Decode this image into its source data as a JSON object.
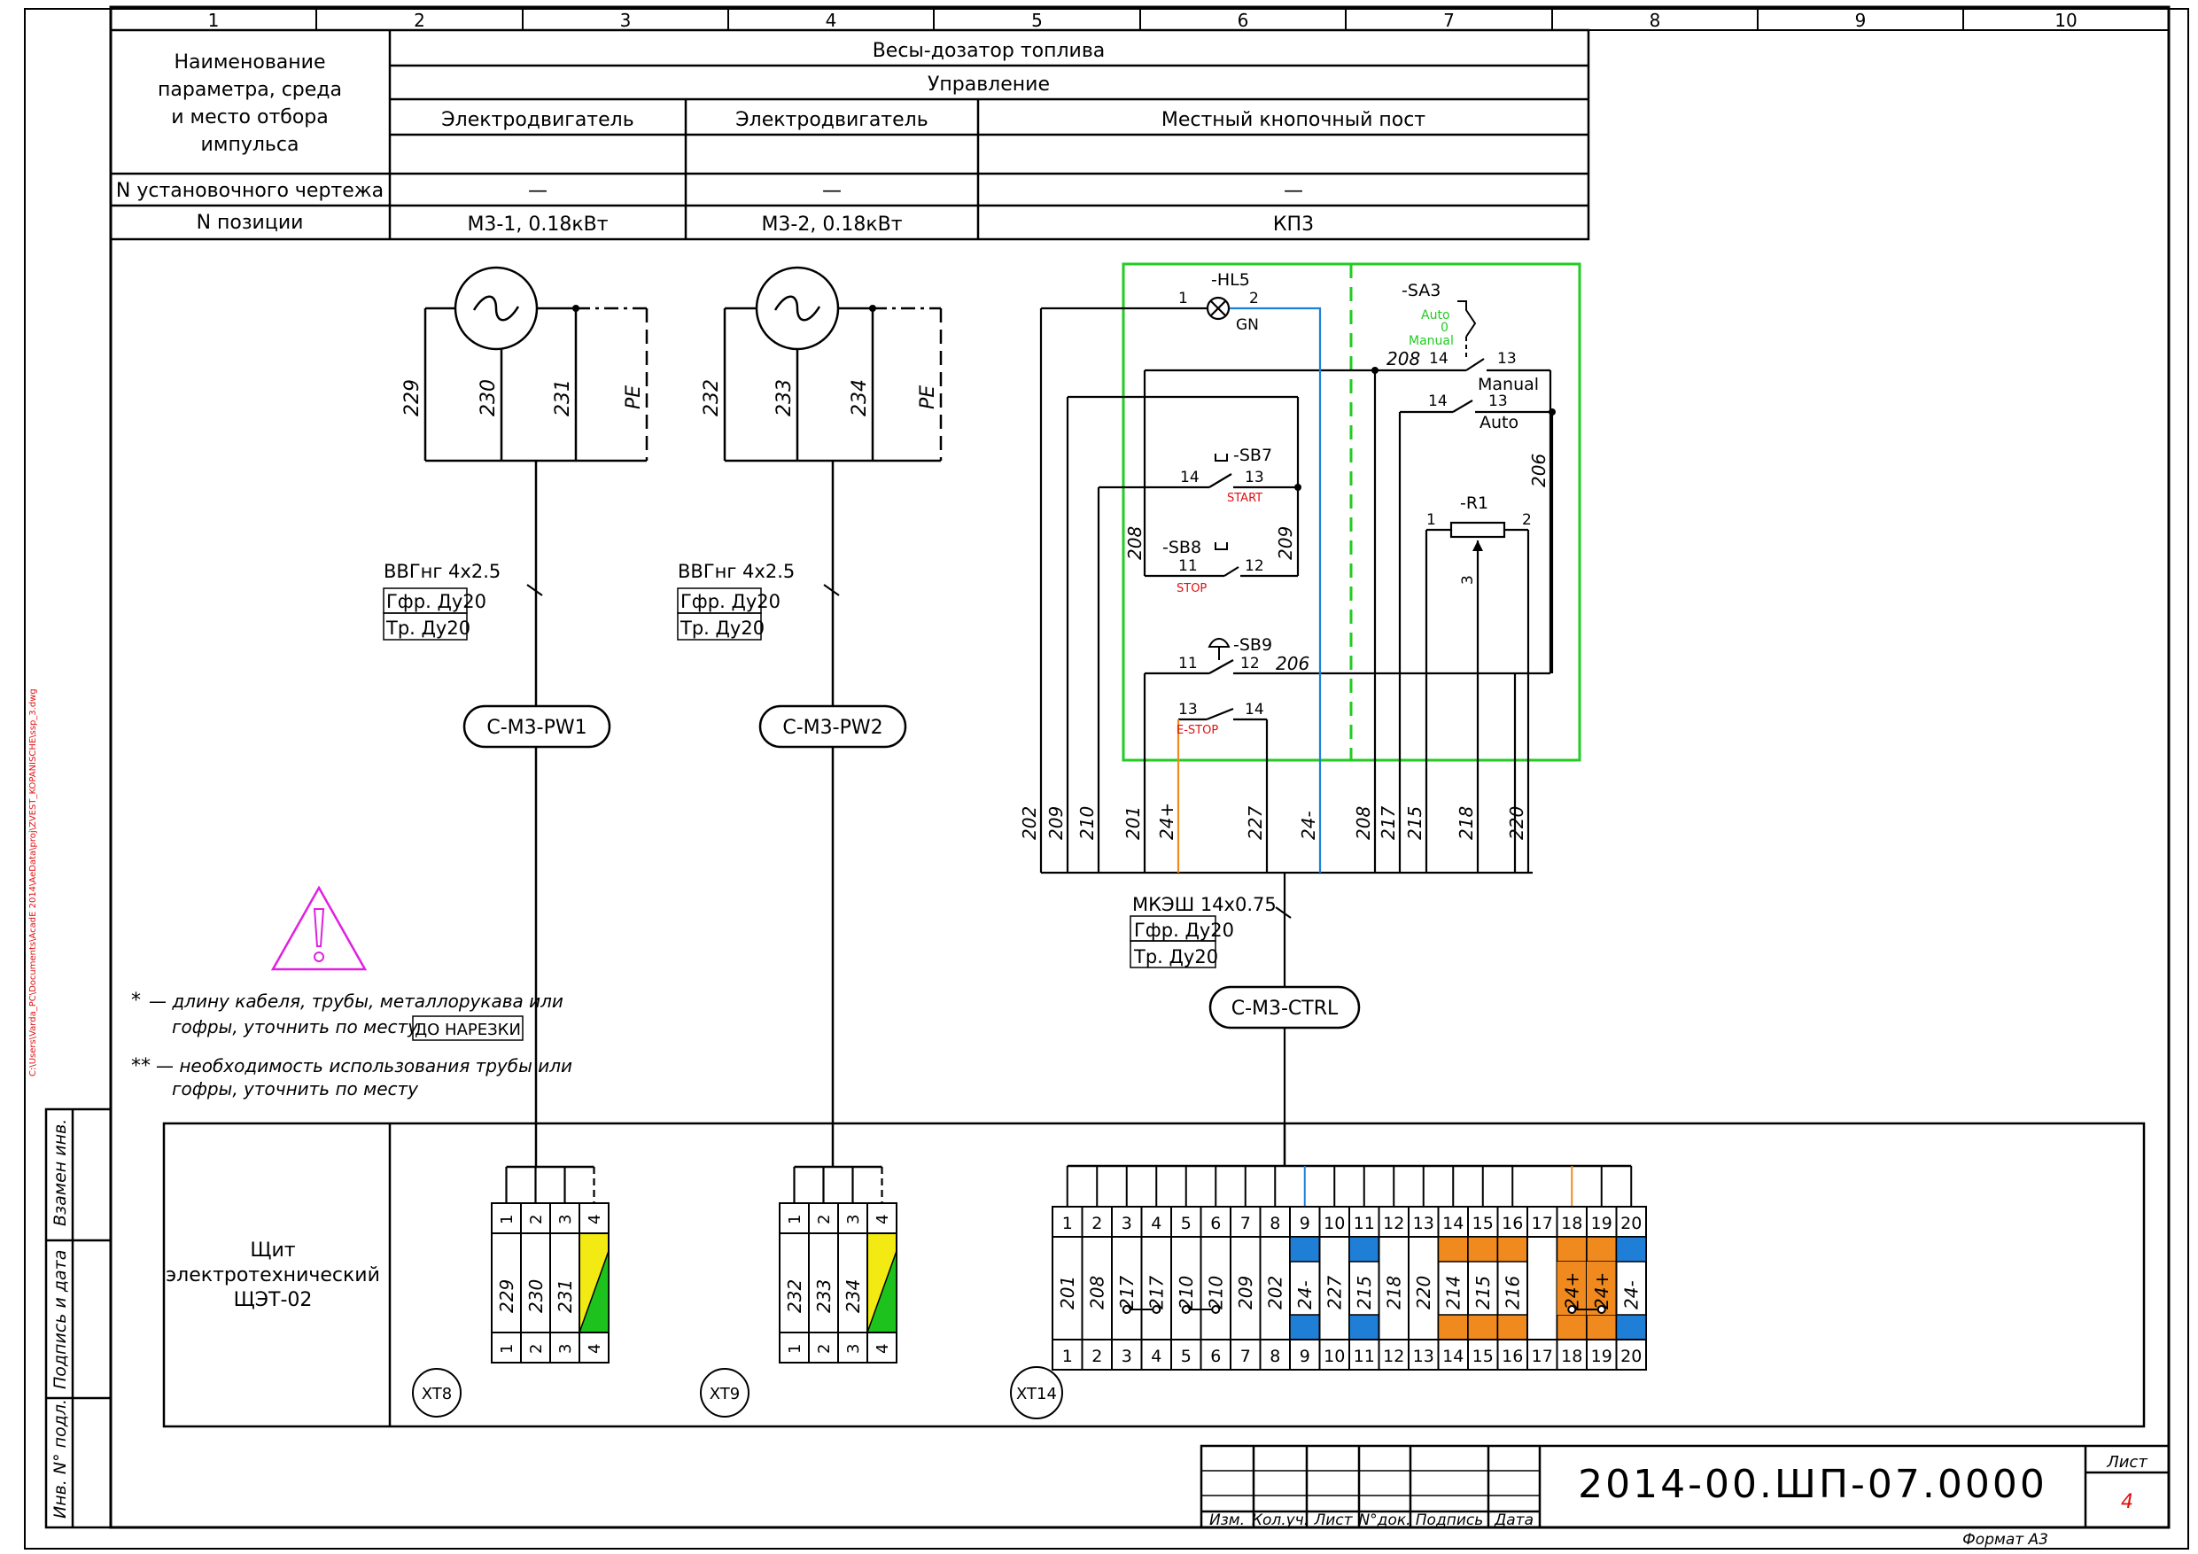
{
  "zones": [
    "1",
    "2",
    "3",
    "4",
    "5",
    "6",
    "7",
    "8",
    "9",
    "10"
  ],
  "sidebar_path": "C:\\Users\\Varda_PC\\Documents\\AcadE 2014\\AeData\\proj\\ZVEST_KOPANISCHE\\ssp_3.dwg",
  "header": {
    "param_label": [
      "Наименование",
      "параметра, среда",
      "и место отбора",
      "импульса"
    ],
    "system": "Весы-дозатор топлива",
    "section": "Управление",
    "col_motor1": "Электродвигатель",
    "col_motor2": "Электродвигатель",
    "col_post": "Местный кнопочный пост",
    "install_drawing_label": "N установочного чертежа",
    "install_drawing_values": [
      "—",
      "—",
      "—"
    ],
    "position_label": "N позиции",
    "position_values": [
      "М3-1, 0.18кВт",
      "М3-2, 0.18кВт",
      "КП3"
    ]
  },
  "motors": [
    {
      "wires": [
        "229",
        "230",
        "231",
        "PE"
      ],
      "cable": "ВВГнг 4х2.5",
      "hose": "Гфр. Ду20",
      "pipe": "Тр. Ду20",
      "cable_id": "C-M3-PW1",
      "terminal": {
        "name": "XT8",
        "nums": [
          "1",
          "2",
          "3",
          "4"
        ],
        "wires": [
          "229",
          "230",
          "231",
          "4"
        ]
      }
    },
    {
      "wires": [
        "232",
        "233",
        "234",
        "PE"
      ],
      "cable": "ВВГнг 4х2.5",
      "hose": "Гфр. Ду20",
      "pipe": "Тр. Ду20",
      "cable_id": "C-M3-PW2",
      "terminal": {
        "name": "XT9",
        "nums": [
          "1",
          "2",
          "3",
          "4"
        ],
        "wires": [
          "232",
          "233",
          "234",
          "4"
        ]
      }
    }
  ],
  "post": {
    "hl5": "-HL5",
    "hl5_p1": "1",
    "hl5_p2": "2",
    "hl5_color": "GN",
    "sa3": "-SA3",
    "sa3_auto": "Auto",
    "sa3_zero": "0",
    "sa3_manual": "Manual",
    "sa3_c1_l": "14",
    "sa3_c1_r": "13",
    "sa3_c1_wire": "208",
    "sa3_c1_label": "Manual",
    "sa3_c2_l": "14",
    "sa3_c2_r": "13",
    "sa3_c2_label": "Auto",
    "sb7": "-SB7",
    "sb7_l": "14",
    "sb7_r": "13",
    "sb7_text": "START",
    "sb8": "-SB8",
    "sb8_l": "11",
    "sb8_r": "12",
    "sb8_text": "STOP",
    "sb9": "-SB9",
    "sb9_t1": "11",
    "sb9_t2": "12",
    "sb9_b1": "13",
    "sb9_b2": "14",
    "sb9_text": "E-STOP",
    "r1": "-R1",
    "r1_p1": "1",
    "r1_p2": "2",
    "r1_p3": "3",
    "wire_208": "208",
    "wire_209": "209",
    "wire_206a": "206",
    "wire_206b": "206",
    "bottom_wires": [
      "202",
      "209",
      "210",
      "201",
      "24+",
      "227",
      "24-",
      "208",
      "217",
      "215",
      "218",
      "220"
    ],
    "cable": "МКЭШ 14х0.75",
    "hose": "Гфр. Ду20",
    "pipe": "Тр. Ду20",
    "cable_id": "C-M3-CTRL"
  },
  "notes": {
    "n1_mark": "*",
    "n1_line1": "— длину кабеля, трубы, металлорукава или",
    "n1_line2": "гофры, уточнить по месту",
    "n1_box": "ДО НАРЕЗКИ",
    "n2_mark": "**",
    "n2_line1": "— необходимость использования трубы или",
    "n2_line2": "гофры, уточнить по месту"
  },
  "panel": {
    "title_lines": [
      "Щит",
      "электротехнический",
      "ЩЭТ-02"
    ],
    "xt14_name": "XT14",
    "xt14_nums": [
      "1",
      "2",
      "3",
      "4",
      "5",
      "6",
      "7",
      "8",
      "9",
      "10",
      "11",
      "12",
      "13",
      "14",
      "15",
      "16",
      "17",
      "18",
      "19",
      "20"
    ],
    "xt14_wires": [
      "201",
      "208",
      "217",
      "217",
      "210",
      "210",
      "209",
      "202",
      "24-",
      "227",
      "215",
      "218",
      "220",
      "214",
      "215",
      "216",
      "",
      "24+",
      "24+",
      "24-"
    ]
  },
  "side_labels": [
    "Взамен инв.",
    "Подпись и дата",
    "Инв. N° подл."
  ],
  "title_block": {
    "cols": [
      "Изм.",
      "Кол.уч.",
      "Лист",
      "N°док.",
      "Подпись",
      "Дата"
    ],
    "doc_number": "2014-00.ШП-07.0000",
    "sheet_label": "Лист",
    "sheet_number": "4",
    "format": "Формат А3"
  },
  "colors": {
    "green": "#22cc22",
    "blue": "#1f7fd6",
    "orange": "#f08a1e",
    "yellow": "#f2ea12",
    "pe_green": "#1dc21d",
    "red": "#e01010",
    "magenta": "#e020e0"
  }
}
